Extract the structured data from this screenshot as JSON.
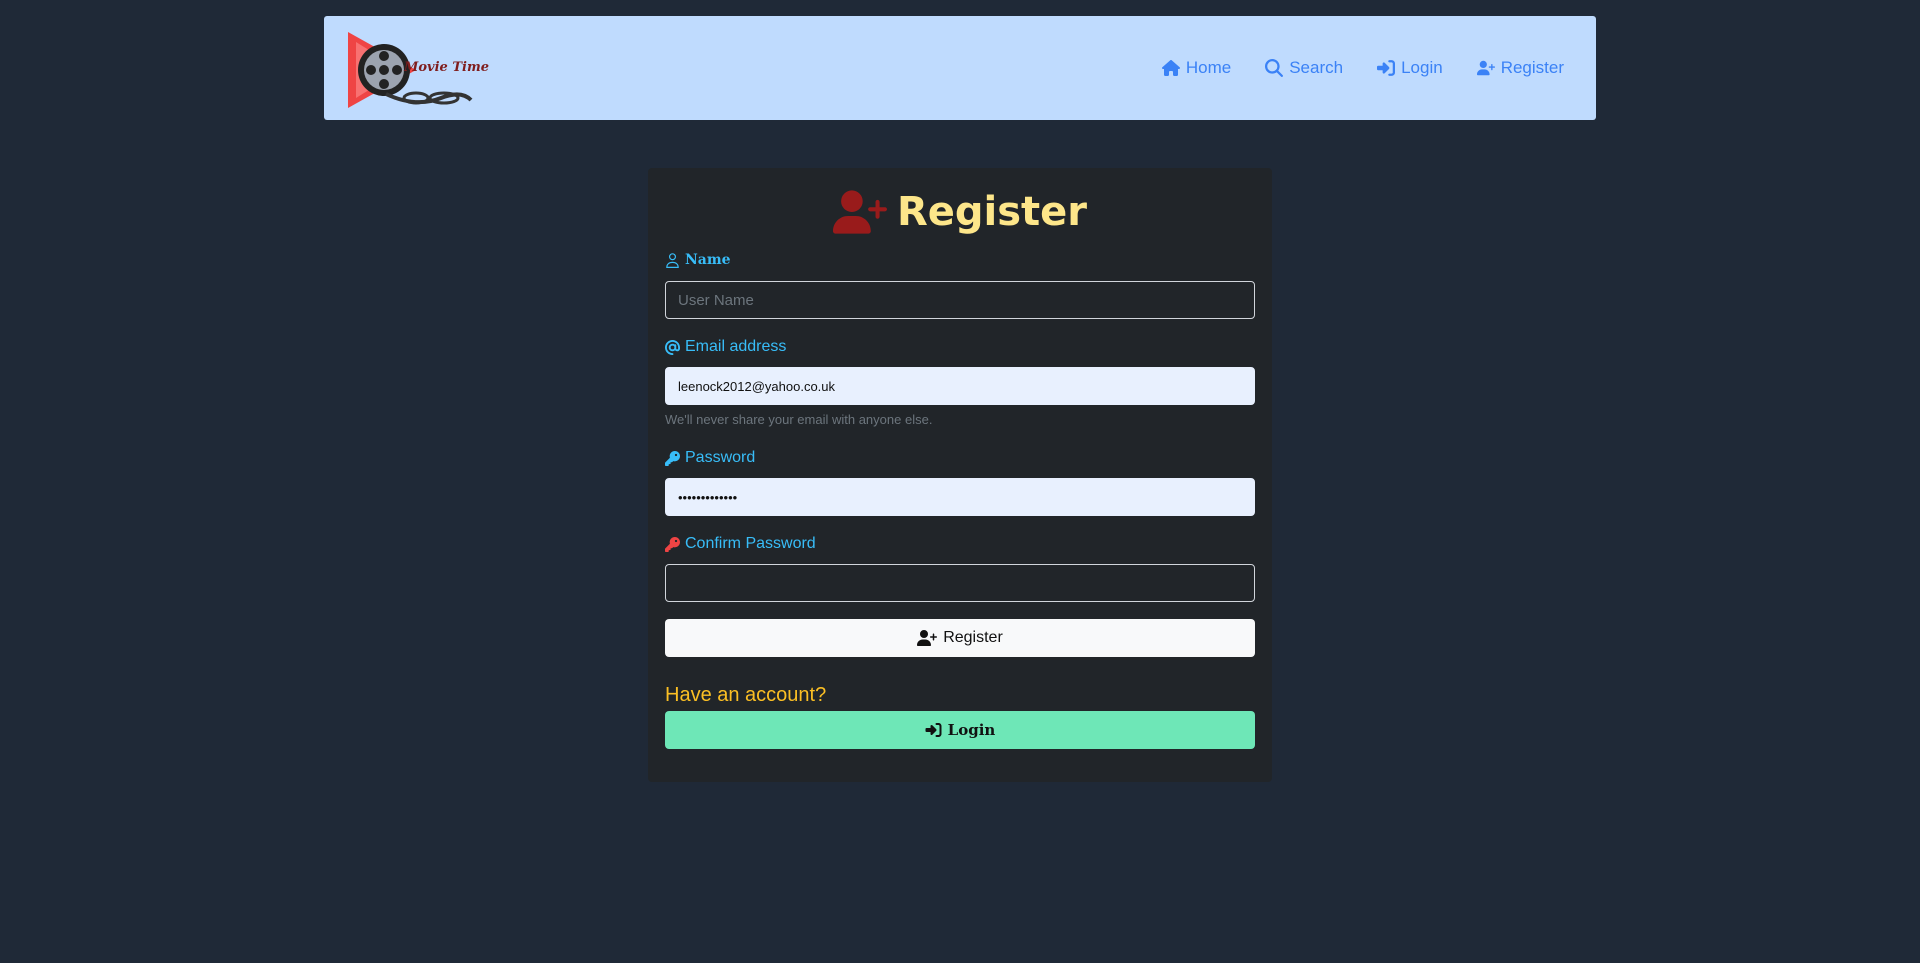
{
  "nav": {
    "logo_text": "Movie Time",
    "items": [
      {
        "label": "Home",
        "icon": "home-icon"
      },
      {
        "label": "Search",
        "icon": "search-icon"
      },
      {
        "label": "Login",
        "icon": "login-icon"
      },
      {
        "label": "Register",
        "icon": "user-plus-icon"
      }
    ]
  },
  "form": {
    "title": "Register",
    "name_label": "Name",
    "name_placeholder": "User Name",
    "email_label": "Email address",
    "email_value": "leenock2012@yahoo.co.uk",
    "email_help": "We'll never share your email with anyone else.",
    "password_label": "Password",
    "password_value": "•••••••••••••",
    "confirm_label": "Confirm Password",
    "confirm_value": "",
    "register_button": "Register",
    "have_account": "Have an account?",
    "login_button": "Login"
  },
  "colors": {
    "page_bg": "#1f2937",
    "navbar_bg": "#bfdbfe",
    "card_bg": "#212529",
    "nav_link": "#3b82f6",
    "title": "#fde68a",
    "label": "#38bdf8",
    "title_icon": "#991b1b",
    "confirm_key_icon": "#ef4444",
    "have_account": "#fbbf24",
    "login_button_bg": "#6ee7b7"
  }
}
